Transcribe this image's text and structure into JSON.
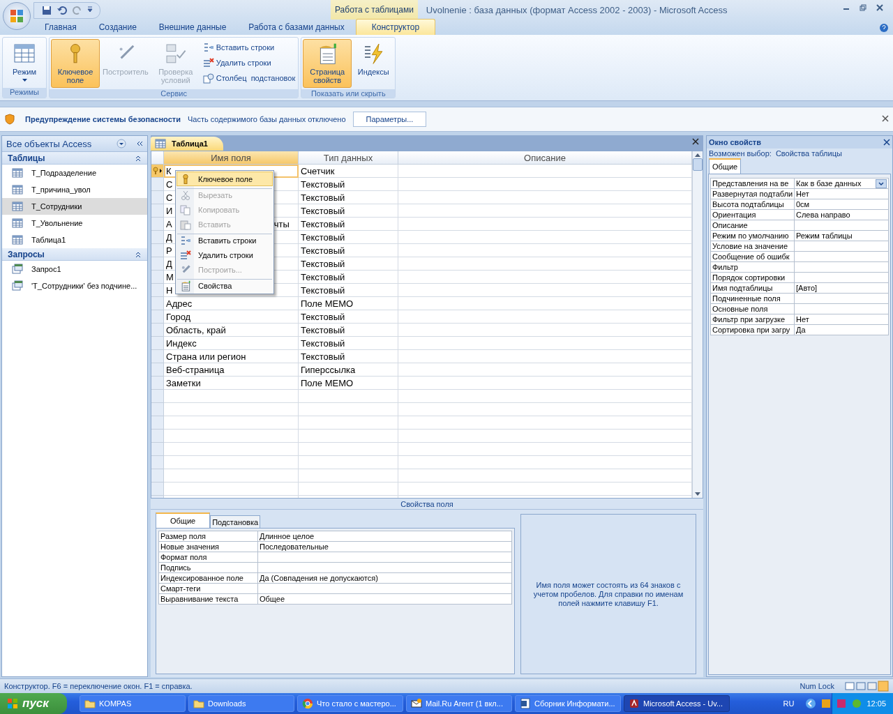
{
  "title_bar": {
    "context_tab": "Работа с таблицами",
    "title": "Uvolnenie : база данных (формат Access 2002 - 2003) - Microsoft Access"
  },
  "ribbon_tabs": [
    {
      "label": "Главная",
      "selected": false
    },
    {
      "label": "Создание",
      "selected": false
    },
    {
      "label": "Внешние данные",
      "selected": false
    },
    {
      "label": "Работа с базами данных",
      "selected": false
    },
    {
      "label": "Конструктор",
      "selected": true
    }
  ],
  "ribbon_groups": [
    {
      "label": "Режимы",
      "buttons": [
        {
          "label": "Режим",
          "kind": "view",
          "large": true,
          "active": false,
          "disabled": false,
          "dropdown": true
        }
      ]
    },
    {
      "label": "Сервис",
      "buttons": [
        {
          "label": "Ключевое поле",
          "kind": "key",
          "large": true,
          "active": true,
          "disabled": false
        },
        {
          "label": "Построитель",
          "kind": "builder",
          "large": true,
          "active": false,
          "disabled": true
        },
        {
          "label": "Проверка условий",
          "kind": "check",
          "large": true,
          "active": false,
          "disabled": true
        },
        {
          "label": "Вставить строки",
          "kind": "insert",
          "large": false,
          "active": false,
          "disabled": false
        },
        {
          "label": "Удалить строки",
          "kind": "delete",
          "large": false,
          "active": false,
          "disabled": false
        },
        {
          "label": "Столбец  подстановок",
          "kind": "lookup",
          "large": false,
          "active": false,
          "disabled": false
        }
      ]
    },
    {
      "label": "Показать или скрыть",
      "buttons": [
        {
          "label": "Страница свойств",
          "kind": "sheet",
          "large": true,
          "active": true,
          "disabled": false
        },
        {
          "label": "Индексы",
          "kind": "index",
          "large": true,
          "active": false,
          "disabled": false
        }
      ]
    }
  ],
  "security_bar": {
    "title": "Предупреждение системы безопасности",
    "message": "Часть содержимого базы данных отключено",
    "button": "Параметры..."
  },
  "nav_pane": {
    "title": "Все объекты Access",
    "groups": [
      {
        "label": "Таблицы",
        "kind": "table",
        "items": [
          {
            "label": "Т_Подразделение",
            "selected": false
          },
          {
            "label": "Т_причина_увол",
            "selected": false
          },
          {
            "label": "Т_Сотрудники",
            "selected": true
          },
          {
            "label": "Т_Увольнение",
            "selected": false
          },
          {
            "label": "Таблица1",
            "selected": false
          }
        ]
      },
      {
        "label": "Запросы",
        "kind": "query",
        "items": [
          {
            "label": "Запрос1",
            "selected": false
          },
          {
            "label": "'Т_Сотрудники' без подчине...",
            "selected": false
          }
        ]
      }
    ]
  },
  "document": {
    "tab": "Таблица1",
    "columns": [
      "Имя поля",
      "Тип данных",
      "Описание"
    ],
    "rows": [
      {
        "name": "К",
        "type": "Счетчик",
        "key": true,
        "selected": true
      },
      {
        "name": "С",
        "type": "Текстовый",
        "key": false,
        "selected": false
      },
      {
        "name": "С",
        "type": "Текстовый",
        "key": false,
        "selected": false
      },
      {
        "name": "И",
        "type": "Текстовый",
        "key": false,
        "selected": false
      },
      {
        "name": "А",
        "name_tail": "чты",
        "type": "Текстовый",
        "key": false,
        "selected": false
      },
      {
        "name": "Д",
        "type": "Текстовый",
        "key": false,
        "selected": false
      },
      {
        "name": "Р",
        "type": "Текстовый",
        "key": false,
        "selected": false
      },
      {
        "name": "Д",
        "type": "Текстовый",
        "key": false,
        "selected": false
      },
      {
        "name": "М",
        "type": "Текстовый",
        "key": false,
        "selected": false
      },
      {
        "name": "Н",
        "type": "Текстовый",
        "key": false,
        "selected": false
      },
      {
        "name": "Адрес",
        "type": "Поле MEMO",
        "key": false,
        "selected": false
      },
      {
        "name": "Город",
        "type": "Текстовый",
        "key": false,
        "selected": false
      },
      {
        "name": "Область, край",
        "type": "Текстовый",
        "key": false,
        "selected": false
      },
      {
        "name": "Индекс",
        "type": "Текстовый",
        "key": false,
        "selected": false
      },
      {
        "name": "Страна или регион",
        "type": "Текстовый",
        "key": false,
        "selected": false
      },
      {
        "name": "Веб-страница",
        "type": "Гиперссылка",
        "key": false,
        "selected": false
      },
      {
        "name": "Заметки",
        "type": "Поле MEMO",
        "key": false,
        "selected": false
      }
    ]
  },
  "context_menu": {
    "items": [
      {
        "label": "Ключевое поле",
        "kind": "key",
        "selected": true,
        "disabled": false,
        "separator_before": false
      },
      {
        "label": "Вырезать",
        "kind": "cut",
        "selected": false,
        "disabled": true,
        "separator_before": true
      },
      {
        "label": "Копировать",
        "kind": "copy",
        "selected": false,
        "disabled": true,
        "separator_before": false
      },
      {
        "label": "Вставить",
        "kind": "paste",
        "selected": false,
        "disabled": true,
        "separator_before": false
      },
      {
        "label": "Вставить строки",
        "kind": "insert",
        "selected": false,
        "disabled": false,
        "separator_before": true
      },
      {
        "label": "Удалить строки",
        "kind": "delete",
        "selected": false,
        "disabled": false,
        "separator_before": false
      },
      {
        "label": "Построить...",
        "kind": "builder",
        "selected": false,
        "disabled": true,
        "separator_before": false
      },
      {
        "label": "Свойства",
        "kind": "sheet",
        "selected": false,
        "disabled": false,
        "separator_before": true
      }
    ]
  },
  "field_properties": {
    "title": "Свойства поля",
    "tabs": [
      {
        "label": "Общие",
        "selected": true
      },
      {
        "label": "Подстановка",
        "selected": false
      }
    ],
    "rows": [
      {
        "label": "Размер поля",
        "value": "Длинное целое"
      },
      {
        "label": "Новые значения",
        "value": "Последовательные"
      },
      {
        "label": "Формат поля"
      },
      {
        "label": "Подпись"
      },
      {
        "label": "Индексированное поле",
        "value": "Да (Совпадения не допускаются)"
      },
      {
        "label": "Смарт-теги"
      },
      {
        "label": "Выравнивание текста",
        "value": "Общее"
      }
    ],
    "help": "Имя поля может состоять из 64 знаков с учетом пробелов.  Для справки по именам полей нажмите клавишу F1."
  },
  "property_sheet": {
    "title": "Окно свойств",
    "selection_label": "Возможен выбор:",
    "selection": "Свойства таблицы",
    "tabs": [
      {
        "label": "Общие",
        "selected": true
      }
    ],
    "rows": [
      {
        "label": "Представления на ве",
        "value": "Как в базе данных",
        "dropdown": true
      },
      {
        "label": "Развернутая подтабли",
        "value": "Нет"
      },
      {
        "label": "Высота подтаблицы",
        "value": "0см"
      },
      {
        "label": "Ориентация",
        "value": "Слева направо"
      },
      {
        "label": "Описание"
      },
      {
        "label": "Режим по умолчанию",
        "value": "Режим таблицы"
      },
      {
        "label": "Условие на значение"
      },
      {
        "label": "Сообщение об ошибк"
      },
      {
        "label": "Фильтр"
      },
      {
        "label": "Порядок сортировки"
      },
      {
        "label": "Имя подтаблицы",
        "value": "[Авто]"
      },
      {
        "label": "Подчиненные поля"
      },
      {
        "label": "Основные поля"
      },
      {
        "label": "Фильтр при загрузке",
        "value": "Нет"
      },
      {
        "label": "Сортировка при загру",
        "value": "Да"
      }
    ]
  },
  "status_bar": {
    "text": "Конструктор.  F6 = переключение окон.  F1 = справка.",
    "indicator": "Num Lock"
  },
  "taskbar": {
    "start": "пуск",
    "tasks": [
      {
        "label": "KOMPAS",
        "kind": "folder",
        "selected": false
      },
      {
        "label": "Downloads",
        "kind": "folder",
        "selected": false
      },
      {
        "label": "Что стало с мастеро...",
        "kind": "browser",
        "selected": false
      },
      {
        "label": "Mail.Ru Агент (1 вкл...",
        "kind": "mail",
        "selected": false
      },
      {
        "label": "Сборник Информати...",
        "kind": "doc",
        "selected": false
      },
      {
        "label": "Microsoft Access - Uv...",
        "kind": "access",
        "selected": true
      }
    ],
    "lang": "RU",
    "clock": "12:05"
  }
}
